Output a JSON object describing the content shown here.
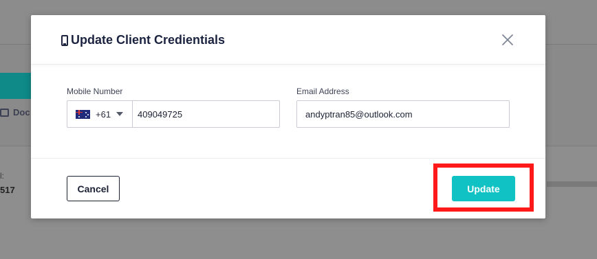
{
  "background": {
    "doc_tab_label": "Doc",
    "detail_label": "l:",
    "detail_value": "517"
  },
  "modal": {
    "title": "Update Client Credientials",
    "mobile_label": "Mobile Number",
    "country_code": "+61",
    "country_flag": "australia-flag",
    "mobile_value": "409049725",
    "email_label": "Email Address",
    "email_value": "andyptran85@outlook.com",
    "cancel_label": "Cancel",
    "update_label": "Update"
  },
  "colors": {
    "accent": "#10c2c4",
    "title": "#1c2340",
    "highlight": "#ff1a1a",
    "overlay": "#8a8a8a"
  }
}
